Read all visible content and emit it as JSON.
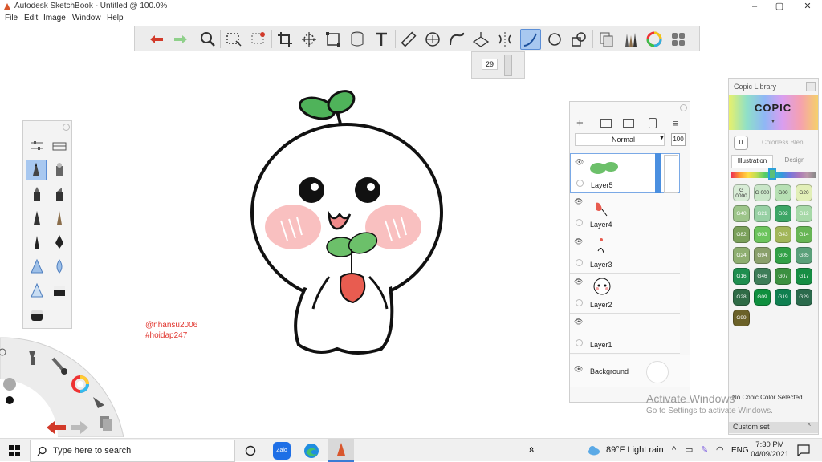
{
  "window": {
    "title": "Autodesk SketchBook - Untitled @ 100.0%",
    "minimize": "–",
    "maximize": "▢",
    "close": "✕"
  },
  "menu": [
    "File",
    "Edit",
    "Image",
    "Window",
    "Help"
  ],
  "toolbar": {
    "tools": [
      "undo-icon",
      "redo-icon",
      "zoom-icon",
      "rect-select-icon",
      "lasso-select-icon",
      "crop-icon",
      "transform-icon",
      "distort-icon",
      "fill-icon",
      "text-icon",
      "ruler-icon",
      "ellipse-guide-icon",
      "french-curve-icon",
      "perspective-icon",
      "symmetry-icon",
      "stroke-icon",
      "ellipse-icon",
      "shape-icon",
      "copy-paste-icon",
      "brush-library-icon",
      "color-wheel-icon",
      "palettes-icon"
    ],
    "active_tool": "stroke-icon",
    "brush_size": "29"
  },
  "layers": {
    "blend_mode": "Normal",
    "opacity": "100",
    "items": [
      {
        "name": "Layer5",
        "selected": true
      },
      {
        "name": "Layer4",
        "selected": false
      },
      {
        "name": "Layer3",
        "selected": false
      },
      {
        "name": "Layer2",
        "selected": false
      },
      {
        "name": "Layer1",
        "selected": false
      }
    ],
    "background": "Background"
  },
  "copic": {
    "title": "Copic Library",
    "logo": "COPIC",
    "colorless_num": "0",
    "colorless_label": "Colorless Blen...",
    "tabs": [
      "Illustration",
      "Design"
    ],
    "swatches": [
      {
        "code": "G 0000",
        "color": "#d8ecd6"
      },
      {
        "code": "G 000",
        "color": "#c9e6c8"
      },
      {
        "code": "G00",
        "color": "#b7e0b4"
      },
      {
        "code": "G20",
        "color": "#e2efb8"
      },
      {
        "code": "G40",
        "color": "#9dc58a"
      },
      {
        "code": "G21",
        "color": "#97d0a4"
      },
      {
        "code": "G02",
        "color": "#3da666"
      },
      {
        "code": "G12",
        "color": "#a7d9a8"
      },
      {
        "code": "G82",
        "color": "#7aa05a"
      },
      {
        "code": "G03",
        "color": "#6cc45d"
      },
      {
        "code": "G43",
        "color": "#a2b65a"
      },
      {
        "code": "G14",
        "color": "#67b555"
      },
      {
        "code": "G24",
        "color": "#8eae70"
      },
      {
        "code": "G94",
        "color": "#8aa06c"
      },
      {
        "code": "G05",
        "color": "#32a046"
      },
      {
        "code": "G85",
        "color": "#5aa07a"
      },
      {
        "code": "G16",
        "color": "#1f8e4f"
      },
      {
        "code": "G46",
        "color": "#3e7d58"
      },
      {
        "code": "G07",
        "color": "#3c9040"
      },
      {
        "code": "G17",
        "color": "#168d43"
      },
      {
        "code": "G28",
        "color": "#2f6b46"
      },
      {
        "code": "G09",
        "color": "#0f8f3e"
      },
      {
        "code": "G19",
        "color": "#0f7f50"
      },
      {
        "code": "G29",
        "color": "#2b6a4c"
      },
      {
        "code": "G99",
        "color": "#6b6128"
      }
    ],
    "status": "No Copic Color Selected",
    "custom_set": "Custom set"
  },
  "canvas": {
    "credit_line1": "@nhansu2006",
    "credit_line2": "#hoidap247"
  },
  "activation": {
    "line1": "Activate Windows",
    "line2": "Go to Settings to activate Windows."
  },
  "taskbar": {
    "search_placeholder": "Type here to search",
    "weather": "89°F  Light rain",
    "language": "ENG",
    "time": "7:30 PM",
    "date": "04/09/2021",
    "zalo": "Zalo"
  }
}
